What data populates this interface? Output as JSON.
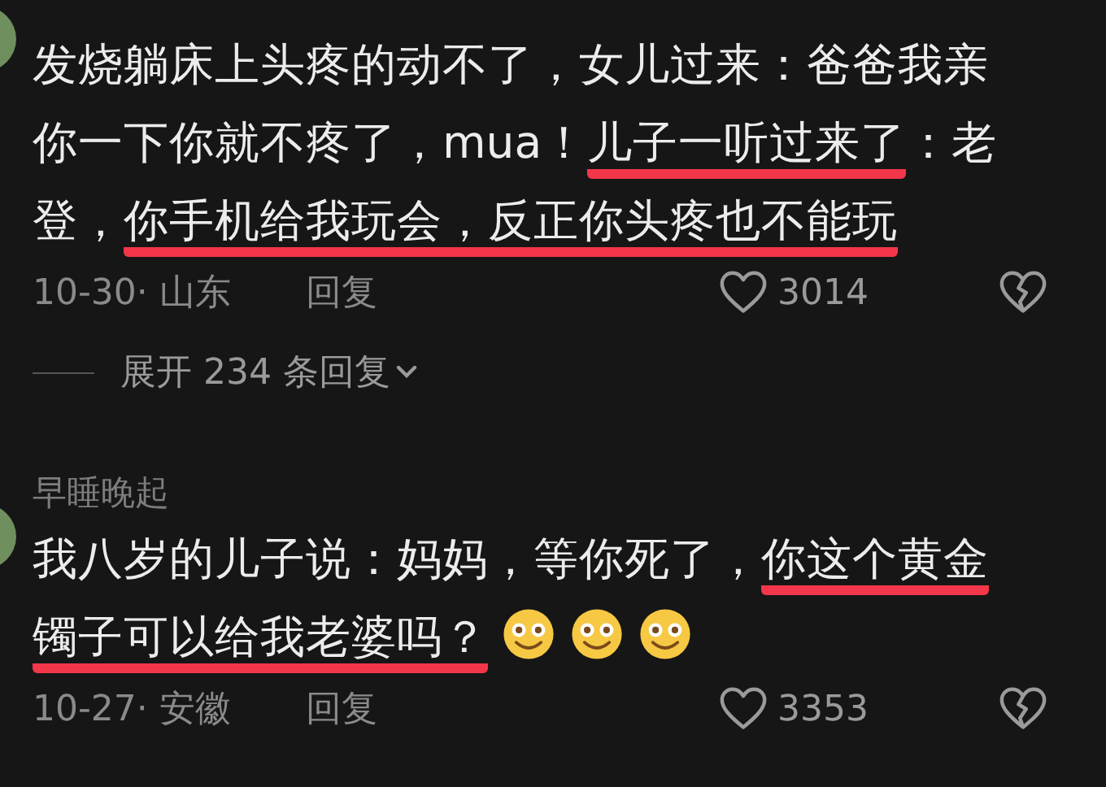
{
  "comments": [
    {
      "segments": [
        {
          "text": "发烧躺床上头疼的动不了，女儿过来：爸爸我亲你一下你就不疼了，mua！",
          "marked": false
        },
        {
          "text": "儿子一听过来了",
          "marked": true
        },
        {
          "text": "：老登，",
          "marked": false
        },
        {
          "text": "你手机给我玩会，反正你头疼也不能玩",
          "marked": true
        }
      ],
      "emoji": false,
      "date_location": "10-30· 山东",
      "reply": "回复",
      "likes": "3014",
      "expand": "展开 234 条回复"
    },
    {
      "user": "早睡晚起",
      "segments": [
        {
          "text": "我八岁的儿子说：妈妈，等你死了，",
          "marked": false
        },
        {
          "text": "你这个黄金镯子可以给我老婆吗？",
          "marked": true
        }
      ],
      "emoji": true,
      "date_location": "10-27· 安徽",
      "reply": "回复",
      "likes": "3353"
    }
  ]
}
